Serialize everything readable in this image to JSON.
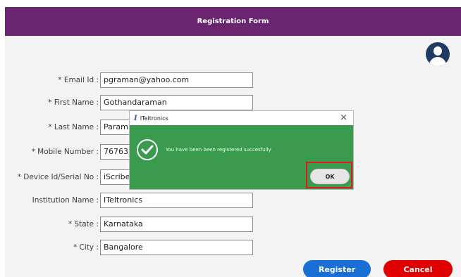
{
  "header": {
    "title": "Registration Form"
  },
  "fields": [
    {
      "label": "* Email Id :",
      "value": "pgraman@yahoo.com"
    },
    {
      "label": "* First Name :",
      "value": "Gothandaraman"
    },
    {
      "label": "* Last Name :",
      "value": "Param"
    },
    {
      "label": "* Mobile Number :",
      "value": "767632"
    },
    {
      "label": "* Device Id/Serial No :",
      "value": "iScribe"
    },
    {
      "label": "Institution Name :",
      "value": "ITeltronics"
    },
    {
      "label": "* State :",
      "value": "Karnataka"
    },
    {
      "label": "* City :",
      "value": "Bangalore"
    }
  ],
  "buttons": {
    "register": "Register",
    "cancel": "Cancel"
  },
  "dialog": {
    "title": "ITeltronics",
    "message": "You have been been registered succesfully",
    "ok": "OK",
    "close": "×",
    "app_icon": "I"
  },
  "colors": {
    "header": "#6a2470",
    "dialog": "#3a9a4e",
    "register": "#1a6fd6",
    "cancel": "#e00000",
    "highlight": "#e01b1b"
  },
  "icons": {
    "avatar": "user-avatar-icon",
    "success": "check-circle-icon",
    "close": "close-icon"
  }
}
